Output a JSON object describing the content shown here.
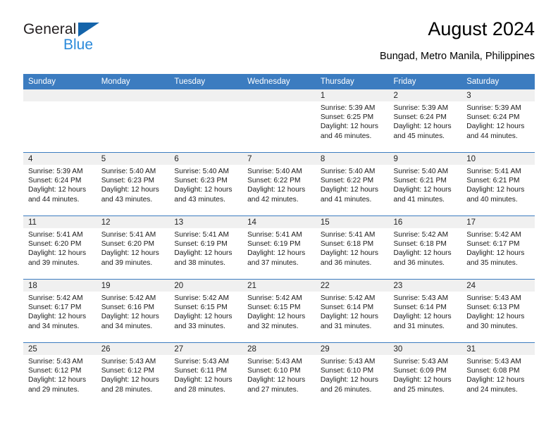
{
  "logo": {
    "word_primary": "General",
    "word_secondary": "Blue",
    "triangle_color": "#1464aa",
    "secondary_color": "#2b8ada"
  },
  "header": {
    "title": "August 2024",
    "subtitle": "Bungad, Metro Manila, Philippines",
    "accent_color": "#3c7cc0"
  },
  "calendar": {
    "weekday_headers": [
      "Sunday",
      "Monday",
      "Tuesday",
      "Wednesday",
      "Thursday",
      "Friday",
      "Saturday"
    ],
    "labels": {
      "sunrise": "Sunrise:",
      "sunset": "Sunset:",
      "daylight": "Daylight:"
    },
    "weeks": [
      [
        {
          "day": "",
          "empty": true
        },
        {
          "day": "",
          "empty": true
        },
        {
          "day": "",
          "empty": true
        },
        {
          "day": "",
          "empty": true
        },
        {
          "day": "1",
          "sunrise": "Sunrise: 5:39 AM",
          "sunset": "Sunset: 6:25 PM",
          "daylight": "Daylight: 12 hours and 46 minutes."
        },
        {
          "day": "2",
          "sunrise": "Sunrise: 5:39 AM",
          "sunset": "Sunset: 6:24 PM",
          "daylight": "Daylight: 12 hours and 45 minutes."
        },
        {
          "day": "3",
          "sunrise": "Sunrise: 5:39 AM",
          "sunset": "Sunset: 6:24 PM",
          "daylight": "Daylight: 12 hours and 44 minutes."
        }
      ],
      [
        {
          "day": "4",
          "sunrise": "Sunrise: 5:39 AM",
          "sunset": "Sunset: 6:24 PM",
          "daylight": "Daylight: 12 hours and 44 minutes."
        },
        {
          "day": "5",
          "sunrise": "Sunrise: 5:40 AM",
          "sunset": "Sunset: 6:23 PM",
          "daylight": "Daylight: 12 hours and 43 minutes."
        },
        {
          "day": "6",
          "sunrise": "Sunrise: 5:40 AM",
          "sunset": "Sunset: 6:23 PM",
          "daylight": "Daylight: 12 hours and 43 minutes."
        },
        {
          "day": "7",
          "sunrise": "Sunrise: 5:40 AM",
          "sunset": "Sunset: 6:22 PM",
          "daylight": "Daylight: 12 hours and 42 minutes."
        },
        {
          "day": "8",
          "sunrise": "Sunrise: 5:40 AM",
          "sunset": "Sunset: 6:22 PM",
          "daylight": "Daylight: 12 hours and 41 minutes."
        },
        {
          "day": "9",
          "sunrise": "Sunrise: 5:40 AM",
          "sunset": "Sunset: 6:21 PM",
          "daylight": "Daylight: 12 hours and 41 minutes."
        },
        {
          "day": "10",
          "sunrise": "Sunrise: 5:41 AM",
          "sunset": "Sunset: 6:21 PM",
          "daylight": "Daylight: 12 hours and 40 minutes."
        }
      ],
      [
        {
          "day": "11",
          "sunrise": "Sunrise: 5:41 AM",
          "sunset": "Sunset: 6:20 PM",
          "daylight": "Daylight: 12 hours and 39 minutes."
        },
        {
          "day": "12",
          "sunrise": "Sunrise: 5:41 AM",
          "sunset": "Sunset: 6:20 PM",
          "daylight": "Daylight: 12 hours and 39 minutes."
        },
        {
          "day": "13",
          "sunrise": "Sunrise: 5:41 AM",
          "sunset": "Sunset: 6:19 PM",
          "daylight": "Daylight: 12 hours and 38 minutes."
        },
        {
          "day": "14",
          "sunrise": "Sunrise: 5:41 AM",
          "sunset": "Sunset: 6:19 PM",
          "daylight": "Daylight: 12 hours and 37 minutes."
        },
        {
          "day": "15",
          "sunrise": "Sunrise: 5:41 AM",
          "sunset": "Sunset: 6:18 PM",
          "daylight": "Daylight: 12 hours and 36 minutes."
        },
        {
          "day": "16",
          "sunrise": "Sunrise: 5:42 AM",
          "sunset": "Sunset: 6:18 PM",
          "daylight": "Daylight: 12 hours and 36 minutes."
        },
        {
          "day": "17",
          "sunrise": "Sunrise: 5:42 AM",
          "sunset": "Sunset: 6:17 PM",
          "daylight": "Daylight: 12 hours and 35 minutes."
        }
      ],
      [
        {
          "day": "18",
          "sunrise": "Sunrise: 5:42 AM",
          "sunset": "Sunset: 6:17 PM",
          "daylight": "Daylight: 12 hours and 34 minutes."
        },
        {
          "day": "19",
          "sunrise": "Sunrise: 5:42 AM",
          "sunset": "Sunset: 6:16 PM",
          "daylight": "Daylight: 12 hours and 34 minutes."
        },
        {
          "day": "20",
          "sunrise": "Sunrise: 5:42 AM",
          "sunset": "Sunset: 6:15 PM",
          "daylight": "Daylight: 12 hours and 33 minutes."
        },
        {
          "day": "21",
          "sunrise": "Sunrise: 5:42 AM",
          "sunset": "Sunset: 6:15 PM",
          "daylight": "Daylight: 12 hours and 32 minutes."
        },
        {
          "day": "22",
          "sunrise": "Sunrise: 5:42 AM",
          "sunset": "Sunset: 6:14 PM",
          "daylight": "Daylight: 12 hours and 31 minutes."
        },
        {
          "day": "23",
          "sunrise": "Sunrise: 5:43 AM",
          "sunset": "Sunset: 6:14 PM",
          "daylight": "Daylight: 12 hours and 31 minutes."
        },
        {
          "day": "24",
          "sunrise": "Sunrise: 5:43 AM",
          "sunset": "Sunset: 6:13 PM",
          "daylight": "Daylight: 12 hours and 30 minutes."
        }
      ],
      [
        {
          "day": "25",
          "sunrise": "Sunrise: 5:43 AM",
          "sunset": "Sunset: 6:12 PM",
          "daylight": "Daylight: 12 hours and 29 minutes."
        },
        {
          "day": "26",
          "sunrise": "Sunrise: 5:43 AM",
          "sunset": "Sunset: 6:12 PM",
          "daylight": "Daylight: 12 hours and 28 minutes."
        },
        {
          "day": "27",
          "sunrise": "Sunrise: 5:43 AM",
          "sunset": "Sunset: 6:11 PM",
          "daylight": "Daylight: 12 hours and 28 minutes."
        },
        {
          "day": "28",
          "sunrise": "Sunrise: 5:43 AM",
          "sunset": "Sunset: 6:10 PM",
          "daylight": "Daylight: 12 hours and 27 minutes."
        },
        {
          "day": "29",
          "sunrise": "Sunrise: 5:43 AM",
          "sunset": "Sunset: 6:10 PM",
          "daylight": "Daylight: 12 hours and 26 minutes."
        },
        {
          "day": "30",
          "sunrise": "Sunrise: 5:43 AM",
          "sunset": "Sunset: 6:09 PM",
          "daylight": "Daylight: 12 hours and 25 minutes."
        },
        {
          "day": "31",
          "sunrise": "Sunrise: 5:43 AM",
          "sunset": "Sunset: 6:08 PM",
          "daylight": "Daylight: 12 hours and 24 minutes."
        }
      ]
    ]
  }
}
